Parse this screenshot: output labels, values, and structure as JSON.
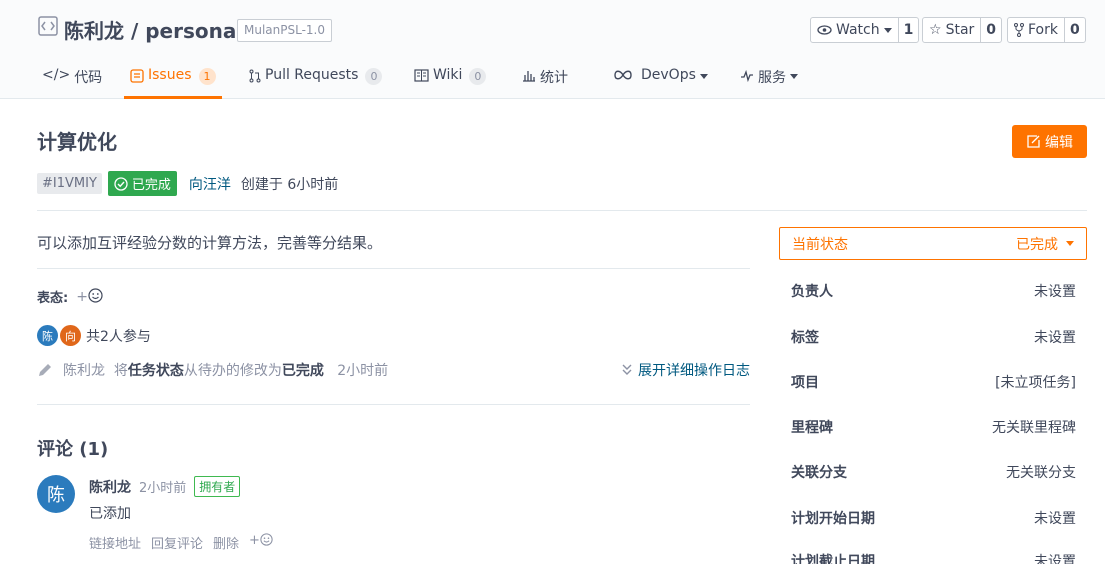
{
  "repo": {
    "title": "陈利龙 / personal",
    "license": "MulanPSL-1.0",
    "watch": {
      "label": "Watch",
      "count": "1"
    },
    "star": {
      "label": "Star",
      "count": "0"
    },
    "fork": {
      "label": "Fork",
      "count": "0"
    }
  },
  "tabs": [
    {
      "label": "代码",
      "icon": "code-icon"
    },
    {
      "label": "Issues",
      "badge": "1",
      "icon": "issues-icon"
    },
    {
      "label": "Pull Requests",
      "badge": "0",
      "icon": "pull-request-icon"
    },
    {
      "label": "Wiki",
      "badge": "0",
      "icon": "wiki-icon"
    },
    {
      "label": "统计",
      "icon": "stats-icon"
    },
    {
      "label": "DevOps",
      "icon": "devops-icon"
    },
    {
      "label": "服务",
      "icon": "service-icon"
    }
  ],
  "issue": {
    "title": "计算优化",
    "edit_label": "编辑",
    "id": "#I1VMIY",
    "state": "已完成",
    "author": "向汪洋",
    "created": "创建于 6小时前",
    "description": "可以添加互评经验分数的计算方法，完善等分结果。",
    "reaction_label": "表态:",
    "participants_text": "共2人参与",
    "participants": [
      "陈",
      "向"
    ],
    "log": {
      "user": "陈利龙",
      "text_a": "将",
      "field": "任务状态",
      "text_b": "从待办的修改为",
      "value": "已完成",
      "time": "2小时前",
      "expand": "展开详细操作日志"
    }
  },
  "comments": {
    "title": "评论 (1)",
    "items": [
      {
        "avatar": "陈",
        "name": "陈利龙",
        "time": "2小时前",
        "role": "拥有者",
        "body": "已添加",
        "actions": [
          "链接地址",
          "回复评论",
          "删除"
        ]
      }
    ]
  },
  "sidebar": {
    "status_label": "当前状态",
    "status_value": "已完成",
    "rows": [
      {
        "key": "负责人",
        "value": "未设置"
      },
      {
        "key": "标签",
        "value": "未设置"
      },
      {
        "key": "项目",
        "value": "[未立项任务]"
      },
      {
        "key": "里程碑",
        "value": "无关联里程碑"
      },
      {
        "key": "关联分支",
        "value": "无关联分支"
      },
      {
        "key": "计划开始日期",
        "value": "未设置"
      },
      {
        "key": "计划截止日期",
        "value": "未设置"
      }
    ]
  },
  "colors": {
    "accent": "#fe7300",
    "success": "#2fa84f",
    "link": "#005980"
  }
}
